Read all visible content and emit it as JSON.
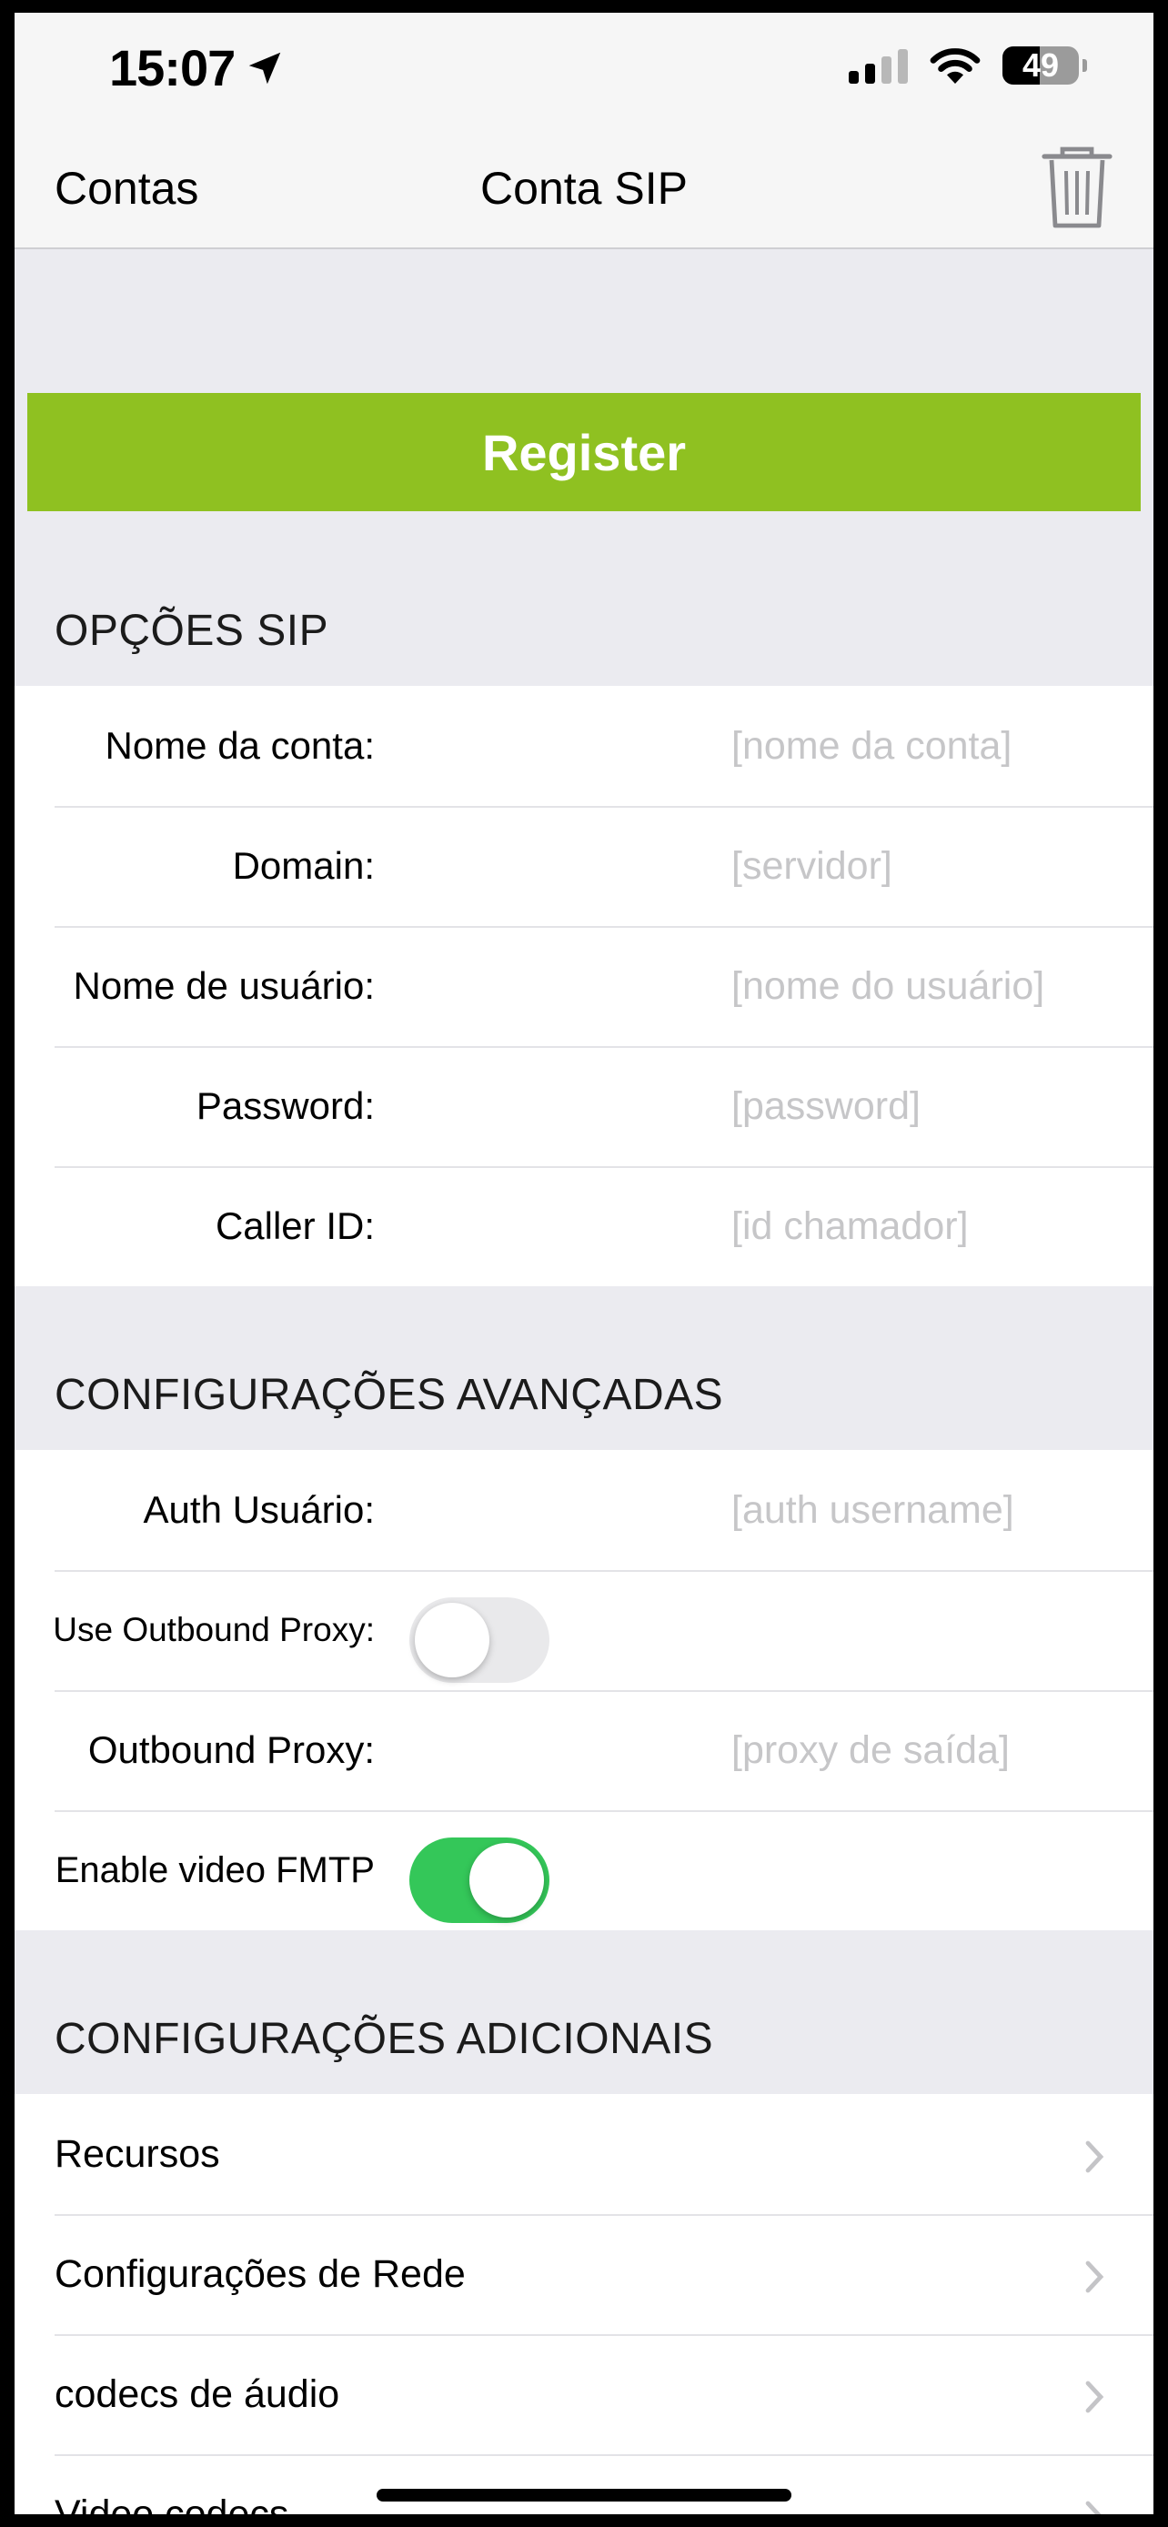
{
  "status": {
    "time": "15:07",
    "battery": "49",
    "location_icon": "location-arrow-icon"
  },
  "nav": {
    "back_label": "Contas",
    "title": "Conta SIP",
    "trash_icon": "trash-icon"
  },
  "register": {
    "label": "Register",
    "color": "#8fc121"
  },
  "sip_options": {
    "header": "OPÇÕES SIP",
    "rows": [
      {
        "label": "Nome da conta:",
        "placeholder": "[nome da conta]"
      },
      {
        "label": "Domain:",
        "placeholder": "[servidor]"
      },
      {
        "label": "Nome de usuário:",
        "placeholder": "[nome do usuário]"
      },
      {
        "label": "Password:",
        "placeholder": "[password]"
      },
      {
        "label": "Caller ID:",
        "placeholder": "[id chamador]"
      }
    ]
  },
  "advanced": {
    "header": "CONFIGURAÇÕES AVANÇADAS",
    "auth_user": {
      "label": "Auth Usuário:",
      "placeholder": "[auth username]"
    },
    "outbound_toggle": {
      "label": "Use Outbound Proxy:",
      "on": false
    },
    "outbound_proxy": {
      "label": "Outbound Proxy:",
      "placeholder": "[proxy de saída]"
    },
    "video_fmtp": {
      "label": "Enable video FMTP",
      "on": true
    },
    "toggle_on_color": "#34c759"
  },
  "additional": {
    "header": "CONFIGURAÇÕES ADICIONAIS",
    "items": [
      {
        "label": "Recursos"
      },
      {
        "label": "Configurações de Rede"
      },
      {
        "label": "codecs de áudio"
      },
      {
        "label": "Video codecs"
      }
    ]
  }
}
